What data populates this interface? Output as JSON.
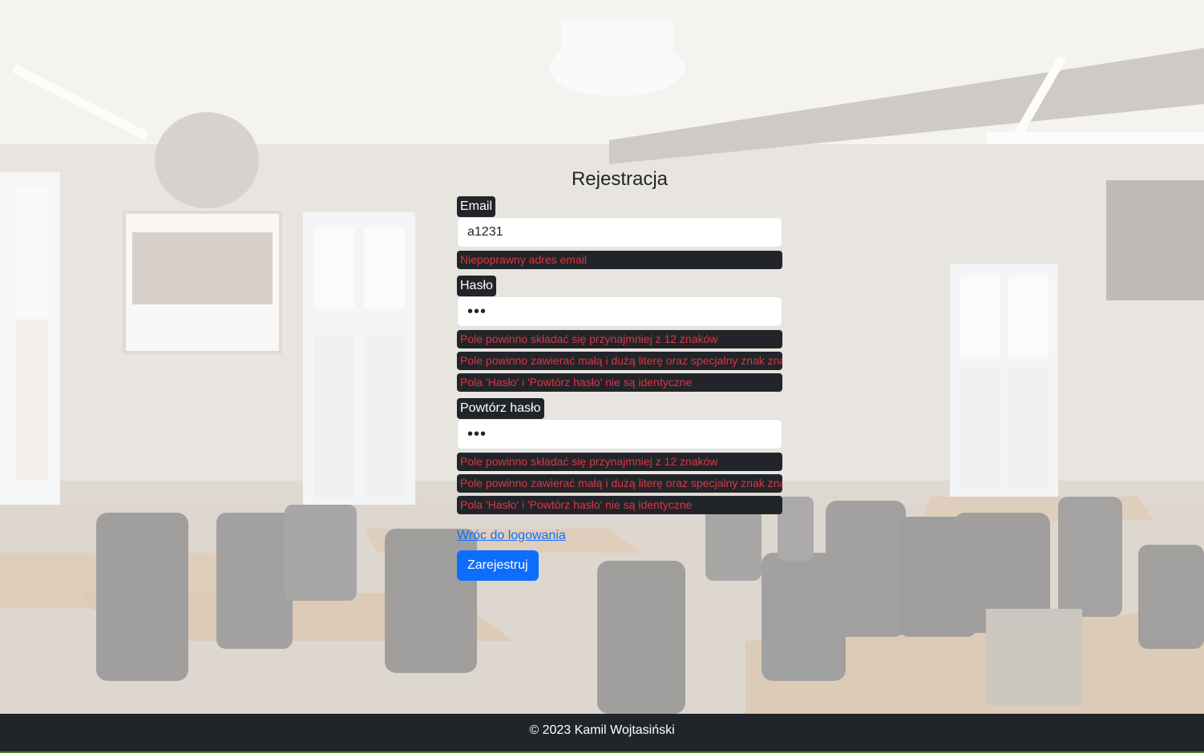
{
  "form": {
    "title": "Rejestracja",
    "email": {
      "label": "Email",
      "value": "a1231",
      "errors": [
        "Niepoprawny adres email"
      ]
    },
    "password": {
      "label": "Hasło",
      "value": "•••",
      "errors": [
        "Pole powinno składać się przynajmniej z 12 znaków",
        "Pole powinno zawierać małą i dużą literę oraz specjalny znak znak",
        "Pola 'Hasło' i 'Powtórz hasło' nie są identyczne"
      ]
    },
    "repeat_password": {
      "label": "Powtórz hasło",
      "value": "•••",
      "errors": [
        "Pole powinno składać się przynajmniej z 12 znaków",
        "Pole powinno zawierać małą i dużą literę oraz specjalny znak znak",
        "Pola 'Hasło' i 'Powtórz hasło' nie są identyczne"
      ]
    },
    "back_link": "Wróc do logowania",
    "submit_label": "Zarejestruj"
  },
  "footer": {
    "text": "© 2023 Kamil Wojtasiński"
  },
  "colors": {
    "label_bg": "#212529",
    "error_text": "#dc3545",
    "primary": "#0d6efd",
    "footer_bg": "#212529"
  }
}
